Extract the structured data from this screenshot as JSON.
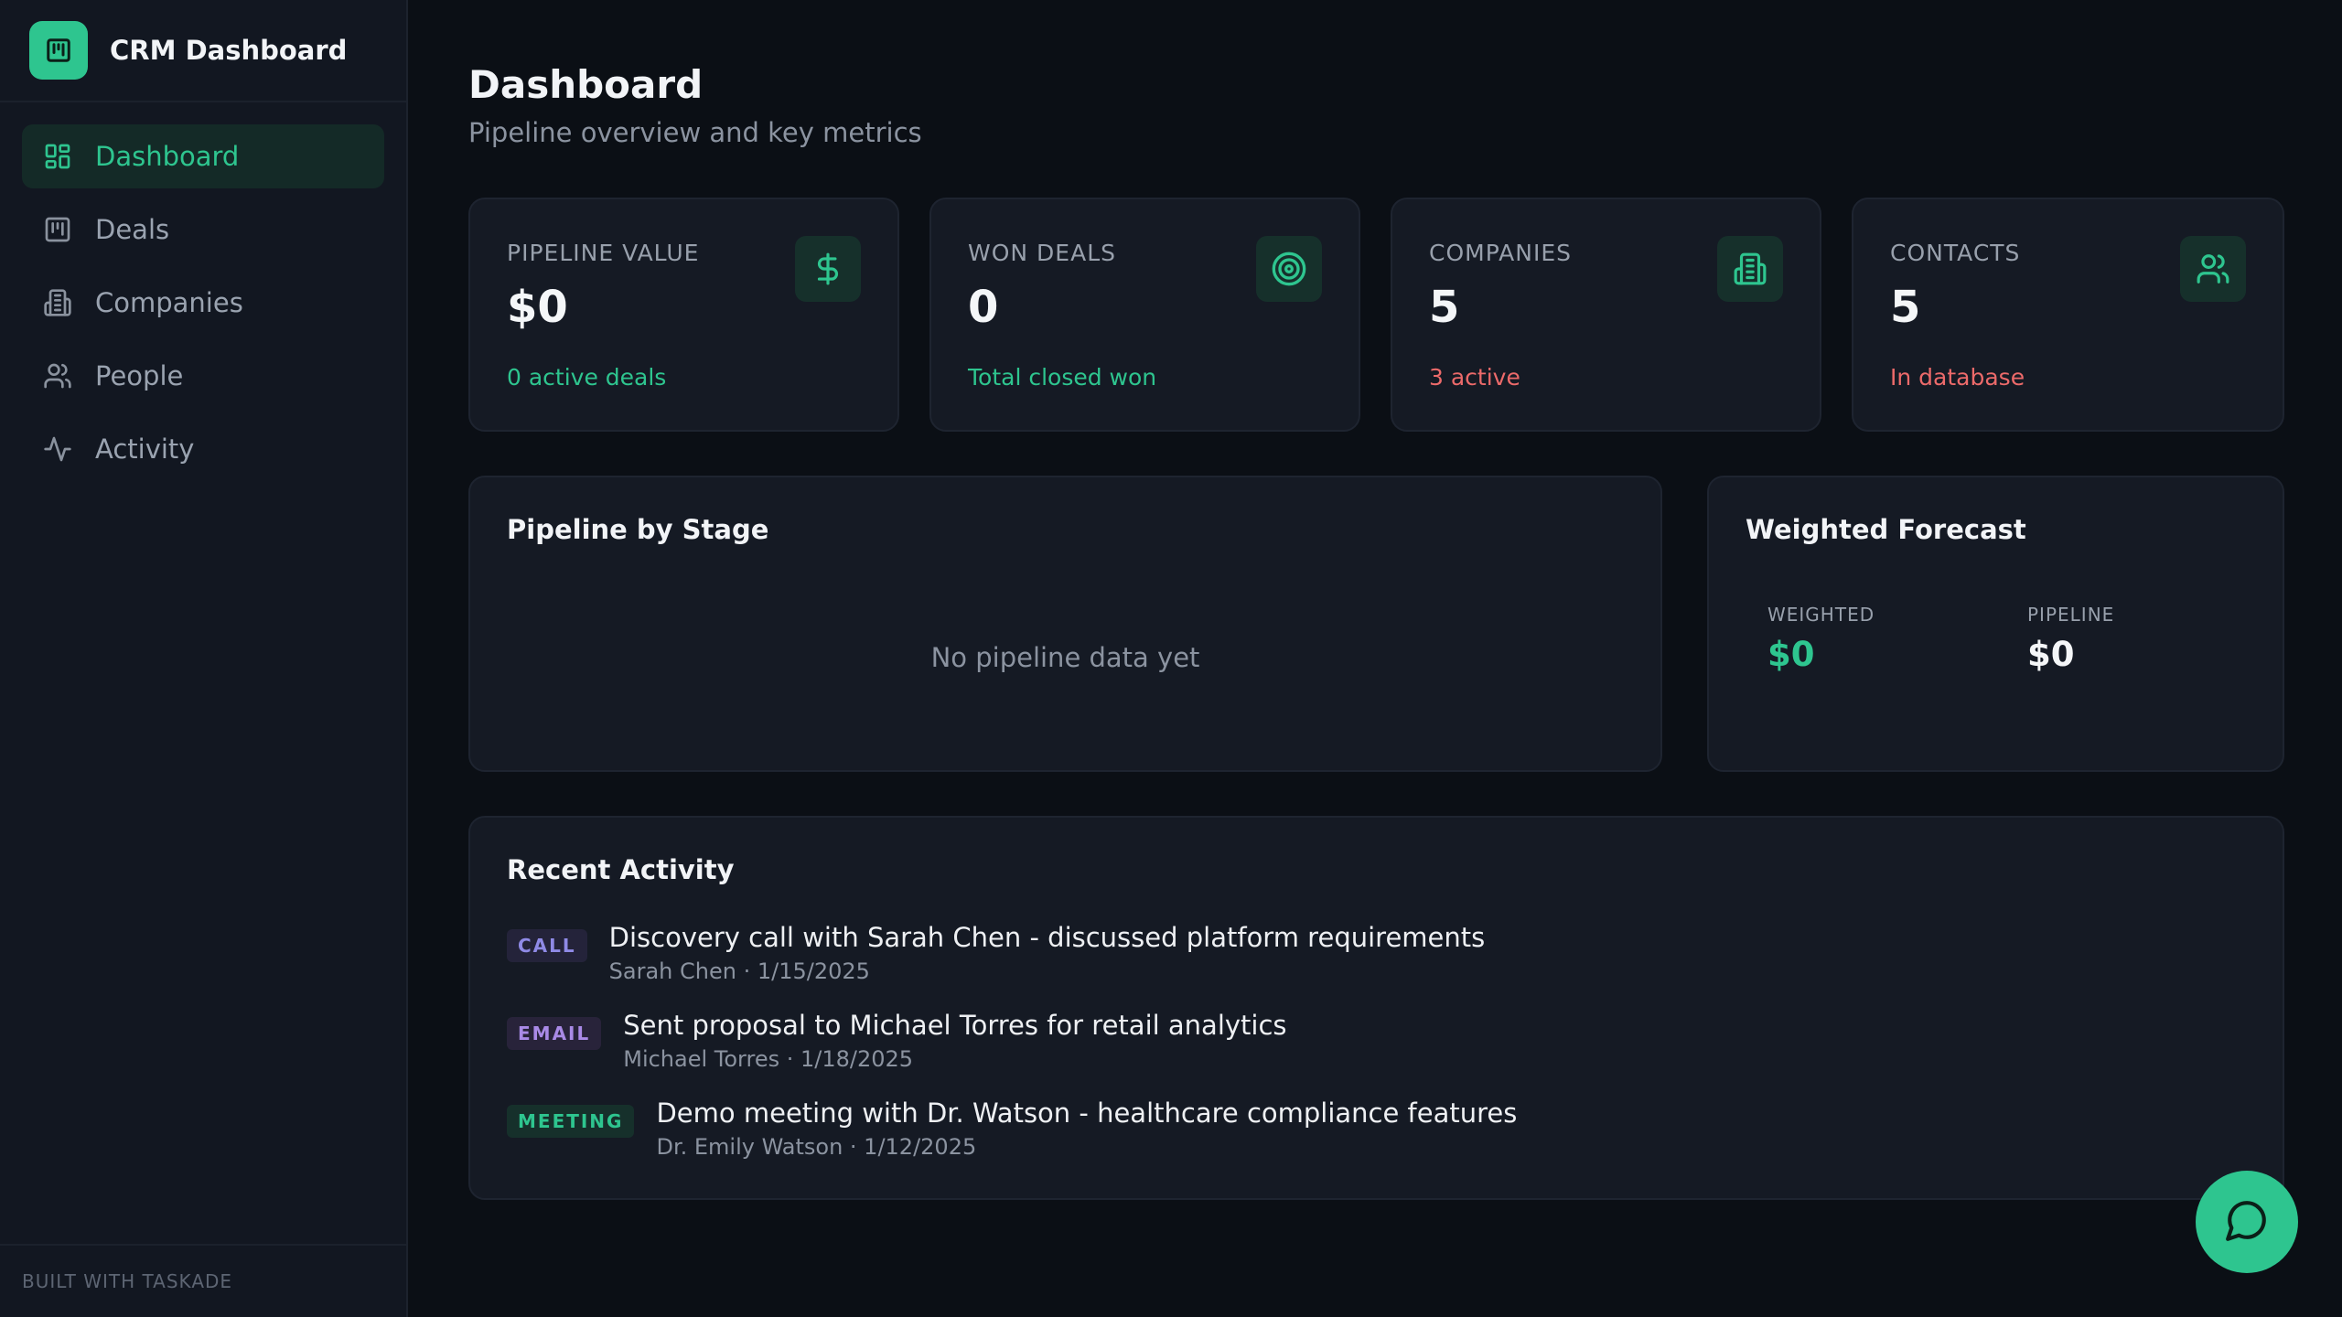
{
  "app": {
    "title": "CRM Dashboard",
    "footer": "BUILT WITH TASKADE"
  },
  "sidebar": {
    "items": [
      {
        "label": "Dashboard",
        "icon": "layout-grid-icon",
        "active": true
      },
      {
        "label": "Deals",
        "icon": "kanban-icon",
        "active": false
      },
      {
        "label": "Companies",
        "icon": "building-icon",
        "active": false
      },
      {
        "label": "People",
        "icon": "users-icon",
        "active": false
      },
      {
        "label": "Activity",
        "icon": "activity-icon",
        "active": false
      }
    ]
  },
  "header": {
    "title": "Dashboard",
    "subtitle": "Pipeline overview and key metrics"
  },
  "stats": [
    {
      "label": "PIPELINE VALUE",
      "value": "$0",
      "sub": "0 active deals",
      "sub_color": "#2ec58f",
      "icon": "dollar-icon"
    },
    {
      "label": "WON DEALS",
      "value": "0",
      "sub": "Total closed won",
      "sub_color": "#2ec58f",
      "icon": "target-icon"
    },
    {
      "label": "COMPANIES",
      "value": "5",
      "sub": "3 active",
      "sub_color": "#ec6a6a",
      "icon": "building-icon"
    },
    {
      "label": "CONTACTS",
      "value": "5",
      "sub": "In database",
      "sub_color": "#ec6a6a",
      "icon": "users-icon"
    }
  ],
  "pipeline": {
    "title": "Pipeline by Stage",
    "empty": "No pipeline data yet"
  },
  "forecast": {
    "title": "Weighted Forecast",
    "weighted_label": "WEIGHTED",
    "weighted_value": "$0",
    "pipeline_label": "PIPELINE",
    "pipeline_value": "$0"
  },
  "activity": {
    "title": "Recent Activity",
    "items": [
      {
        "type": "CALL",
        "title": "Discovery call with Sarah Chen - discussed platform requirements",
        "meta": "Sarah Chen · 1/15/2025",
        "badge_color": "#8f8ae6",
        "badge_bg": "#24233a"
      },
      {
        "type": "EMAIL",
        "title": "Sent proposal to Michael Torres for retail analytics",
        "meta": "Michael Torres · 1/18/2025",
        "badge_color": "#a98ae6",
        "badge_bg": "#28233a"
      },
      {
        "type": "MEETING",
        "title": "Demo meeting with Dr. Watson - healthcare compliance features",
        "meta": "Dr. Emily Watson · 1/12/2025",
        "badge_color": "#2ec58f",
        "badge_bg": "#16302b"
      }
    ]
  },
  "colors": {
    "accent": "#2ec58f",
    "background": "#0b0f15",
    "card": "#151a24",
    "sidebar": "#121721",
    "danger": "#ec6a6a"
  }
}
